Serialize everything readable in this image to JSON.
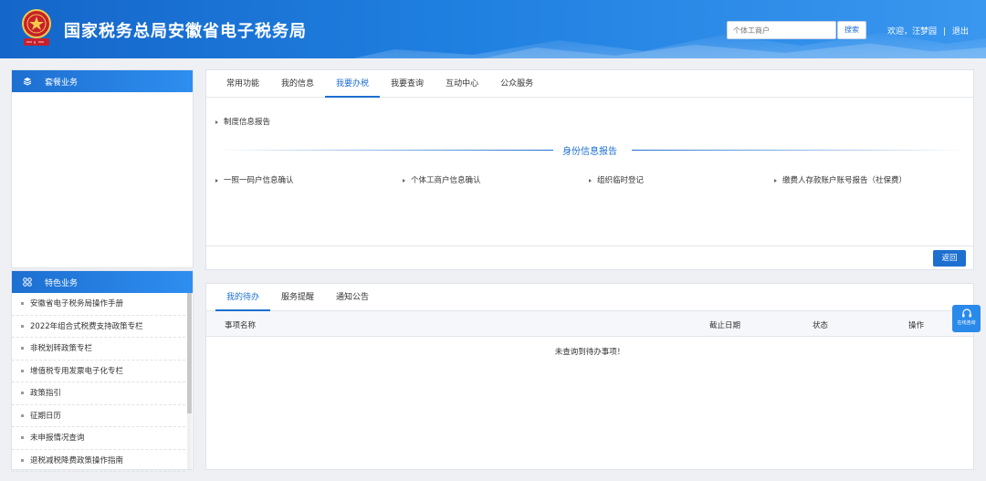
{
  "header": {
    "site_title": "国家税务总局安徽省电子税务局",
    "emblem_seal_text": "中国税务",
    "search_placeholder": "个体工商户",
    "search_button": "搜索",
    "welcome": "欢迎，汪梦园",
    "separator": "|",
    "logout": "退出"
  },
  "sidebar": {
    "package": {
      "title": "套餐业务",
      "icon": "layers-icon"
    },
    "featured": {
      "title": "特色业务",
      "icon": "grid-icon",
      "items": [
        {
          "label": "安徽省电子税务局操作手册"
        },
        {
          "label": "2022年组合式税费支持政策专栏"
        },
        {
          "label": "非税划转政策专栏"
        },
        {
          "label": "增值税专用发票电子化专栏"
        },
        {
          "label": "政策指引"
        },
        {
          "label": "征期日历"
        },
        {
          "label": "未申报情况查询"
        },
        {
          "label": "退税减税降费政策操作指南"
        }
      ]
    }
  },
  "main": {
    "tabs": [
      {
        "label": "常用功能"
      },
      {
        "label": "我的信息"
      },
      {
        "label": "我要办税",
        "active": true
      },
      {
        "label": "我要查询"
      },
      {
        "label": "互动中心"
      },
      {
        "label": "公众服务"
      }
    ],
    "section_link": "制度信息报告",
    "group_title": "身份信息报告",
    "items": [
      {
        "label": "一照一码户信息确认"
      },
      {
        "label": "个体工商户信息确认"
      },
      {
        "label": "组织临时登记"
      },
      {
        "label": "缴费人存款账户账号报告（社保费）"
      }
    ],
    "back_button": "返回"
  },
  "todo": {
    "tabs": [
      {
        "label": "我的待办",
        "active": true
      },
      {
        "label": "服务提醒"
      },
      {
        "label": "通知公告"
      }
    ],
    "columns": {
      "name": "事项名称",
      "deadline": "截止日期",
      "status": "状态",
      "action": "操作"
    },
    "empty_message": "未查询到待办事项！"
  },
  "online_service": {
    "label": "在线咨询",
    "icon": "headset-icon"
  },
  "colors": {
    "brand": "#1d6fd0",
    "header_gradient_end": "#3a97ef"
  }
}
